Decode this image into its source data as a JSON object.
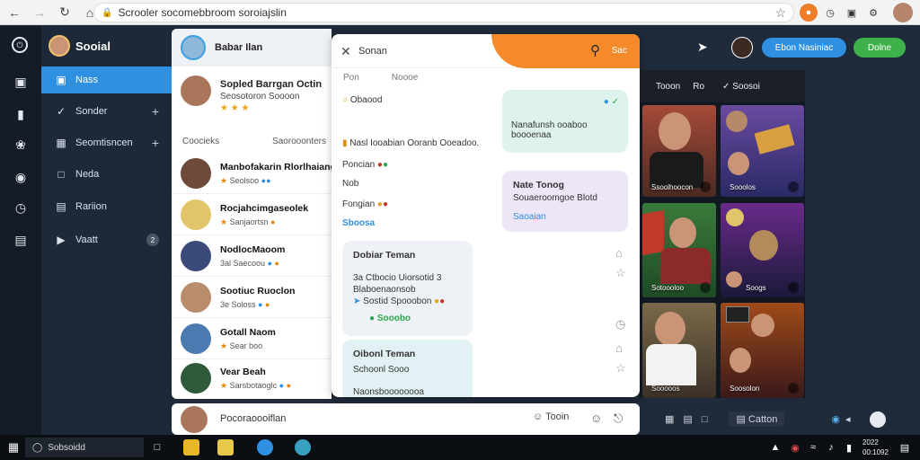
{
  "browser": {
    "address": "Scrooler socomebbroom soroiajslin",
    "nav": {
      "back_icon": "back-arrow-icon",
      "forward_icon": "forward-arrow-icon",
      "reload_icon": "reload-icon",
      "home_icon": "home-icon"
    }
  },
  "sidebar": {
    "brand": "Sooial",
    "items": [
      {
        "label": "Nass",
        "icon": "image-icon",
        "active": true
      },
      {
        "label": "Sonder",
        "icon": "bolt-icon",
        "plus": "+"
      },
      {
        "label": "Seomtisncen",
        "icon": "gallery-icon",
        "plus": "+"
      },
      {
        "label": "Neda",
        "icon": "doc-icon"
      },
      {
        "label": "Rariion",
        "icon": "chart-icon"
      },
      {
        "label": "Vaatt",
        "icon": "video-icon",
        "count": "2"
      }
    ]
  },
  "contacts": {
    "header": "Babar Ilan",
    "profile": {
      "name": "Sopled Barrgan Octin",
      "sub": "Seosotoron Soooon",
      "stars": "★ ★ ★"
    },
    "col_left": "Coocieks",
    "col_right": "Saorooonters",
    "list": [
      {
        "name": "Manbofakarin Rlorlhaiang",
        "meta": "Seolsoo",
        "time": ""
      },
      {
        "name": "Rocjahcimgaseolek",
        "meta": "Sanjaortsn",
        "time": ""
      },
      {
        "name": "NodlocMaoom",
        "meta": "3al Saecoou",
        "time": ""
      },
      {
        "name": "Sootiuc Ruoclon",
        "meta": "3e Soloss",
        "time": ""
      },
      {
        "name": "Gotall Naom",
        "meta": "Sear boo",
        "time": ""
      },
      {
        "name": "Vear Beah",
        "meta": "Sarsbotaoglc",
        "time": ""
      }
    ]
  },
  "chat": {
    "title": "Sonan",
    "header_label": "Sac",
    "tabs": [
      "Pon",
      "Noooe"
    ],
    "lines": [
      {
        "text": "Obaood"
      },
      {
        "text": "Nasl Iooabian Ooranb Ooeadoo."
      },
      {
        "text": "Poncian"
      },
      {
        "text": "Nob"
      },
      {
        "text": "Fongian"
      },
      {
        "text": "Sboosa"
      }
    ],
    "bubble1": "Nanafunsh ooaboo boooenaa",
    "bubble2": {
      "title": "Nate Tonog",
      "body": "Souaeroomgoe Blotd",
      "link": "Saoaian"
    },
    "bubble3": {
      "title": "Dobiar Teman",
      "line1": "3a Ctbocio Uiorsotid 3",
      "line2": "Blaboenaonsob",
      "line3": "Sostid Spooobon",
      "status": "Sooobo"
    },
    "bubble4": {
      "title": "Oibonl Teman",
      "line1": "Schoonl Sooo",
      "line2": "Naonsboooooooa"
    }
  },
  "media": {
    "tabs": [
      "Tooon",
      "Ro",
      "Soosoi"
    ],
    "captions": [
      "Ssoolhoocon",
      "Sooolos",
      "Sotoooloo",
      "Soogs",
      "Sooooos",
      "Soosolon"
    ]
  },
  "header_right": {
    "btn_primary": "Ebon Nasiniac",
    "btn_secondary": "Dolne"
  },
  "composer": {
    "text": "Pocoraoooiflan",
    "right_text": "Tooin",
    "tool_label": "Catton"
  },
  "taskbar": {
    "search": "Sobsoidd",
    "time": "2022",
    "date": "00:1092"
  }
}
